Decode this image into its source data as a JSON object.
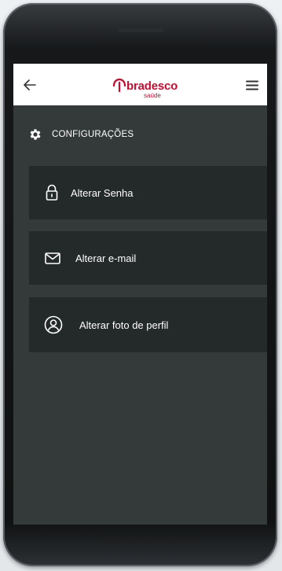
{
  "brand": {
    "name": "bradesco",
    "product": "saúde",
    "color": "#cc092f"
  },
  "appbar": {
    "back_icon": "arrow-left-icon",
    "menu_icon": "hamburger-menu-icon"
  },
  "section": {
    "title": "CONFIGURAÇÕES",
    "icon": "gear-icon"
  },
  "options": [
    {
      "label": "Alterar Senha",
      "icon": "lock-icon"
    },
    {
      "label": "Alterar e-mail",
      "icon": "envelope-icon"
    },
    {
      "label": "Alterar foto de perfil",
      "icon": "user-circle-icon"
    }
  ],
  "colors": {
    "screen_background": "#343a3a",
    "card_background": "#24292a",
    "text": "#ffffff"
  }
}
